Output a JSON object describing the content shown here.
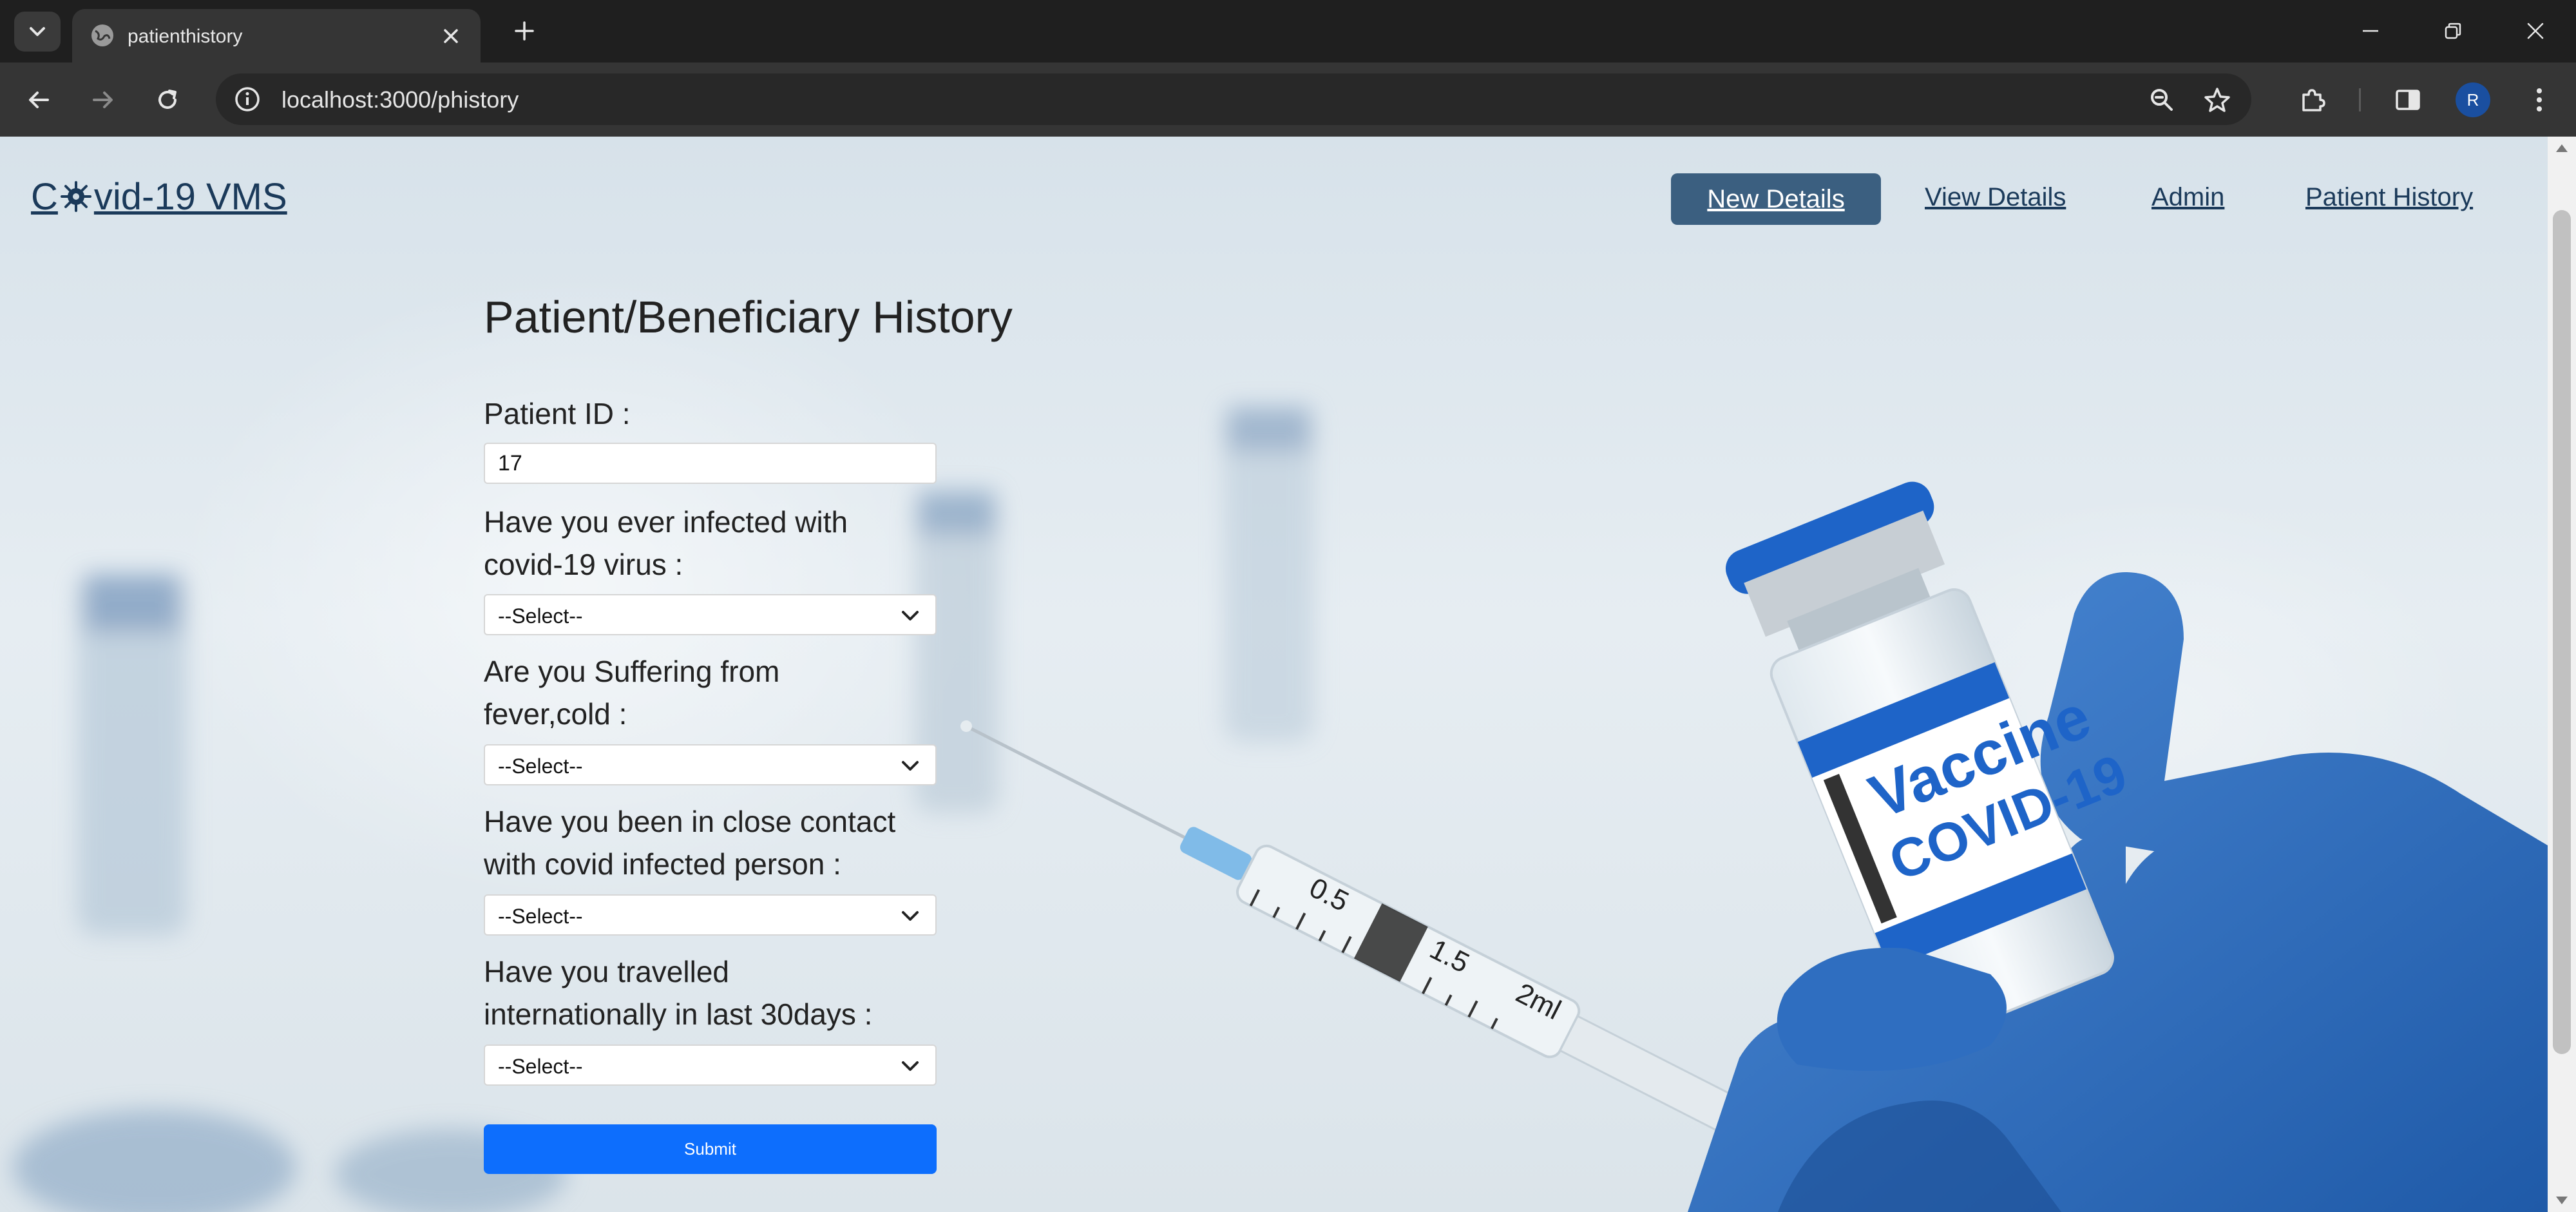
{
  "browser": {
    "tab_title": "patienthistory",
    "url_host": "localhost",
    "url_rest": ":3000/phistory",
    "profile_initial": "R"
  },
  "site": {
    "brand_prefix": "C",
    "brand_suffix": "vid-19 VMS",
    "nav": [
      {
        "label": "New Details",
        "active": true
      },
      {
        "label": "View Details"
      },
      {
        "label": "Admin"
      },
      {
        "label": "Patient History"
      }
    ]
  },
  "form": {
    "title": "Patient/Beneficiary History",
    "patient_id_label": "Patient ID :",
    "patient_id_value": "17",
    "q1_line1": "Have you ever infected with",
    "q1_line2": "covid-19 virus :",
    "q1_value": "--Select--",
    "q2_line1": "Are you Suffering from",
    "q2_line2": "fever,cold :",
    "q2_value": "--Select--",
    "q3_line1": "Have you been in close contact",
    "q3_line2": "with covid infected person :",
    "q3_value": "--Select--",
    "q4_line1": "Have you travelled",
    "q4_line2": "internationally in last 30days :",
    "q4_value": "--Select--",
    "submit_label": "Submit"
  },
  "image": {
    "vial_text_1": "Vaccine",
    "vial_text_2": "COVID-19",
    "syringe_mark_1": "0.5",
    "syringe_mark_2": "1.5",
    "syringe_mark_3": "2ml"
  },
  "icons": {
    "tab_menu": "chevron-down-icon",
    "favicon": "globe-icon",
    "close": "close-icon",
    "new_tab": "plus-icon",
    "minimize": "minimize-icon",
    "restore": "restore-icon",
    "window_close": "close-icon",
    "back": "back-arrow-icon",
    "forward": "forward-arrow-icon",
    "reload": "reload-icon",
    "site_info": "info-icon",
    "zoom": "zoom-icon",
    "bookmark": "star-icon",
    "extensions": "puzzle-icon",
    "side_panel": "side-panel-icon",
    "menu": "kebab-menu-icon"
  },
  "colors": {
    "brand_text": "#1b3a5a",
    "active_nav_bg": "#3b5f80",
    "submit_bg": "#0d6efd",
    "glove_blue": "#2c6fc2"
  }
}
